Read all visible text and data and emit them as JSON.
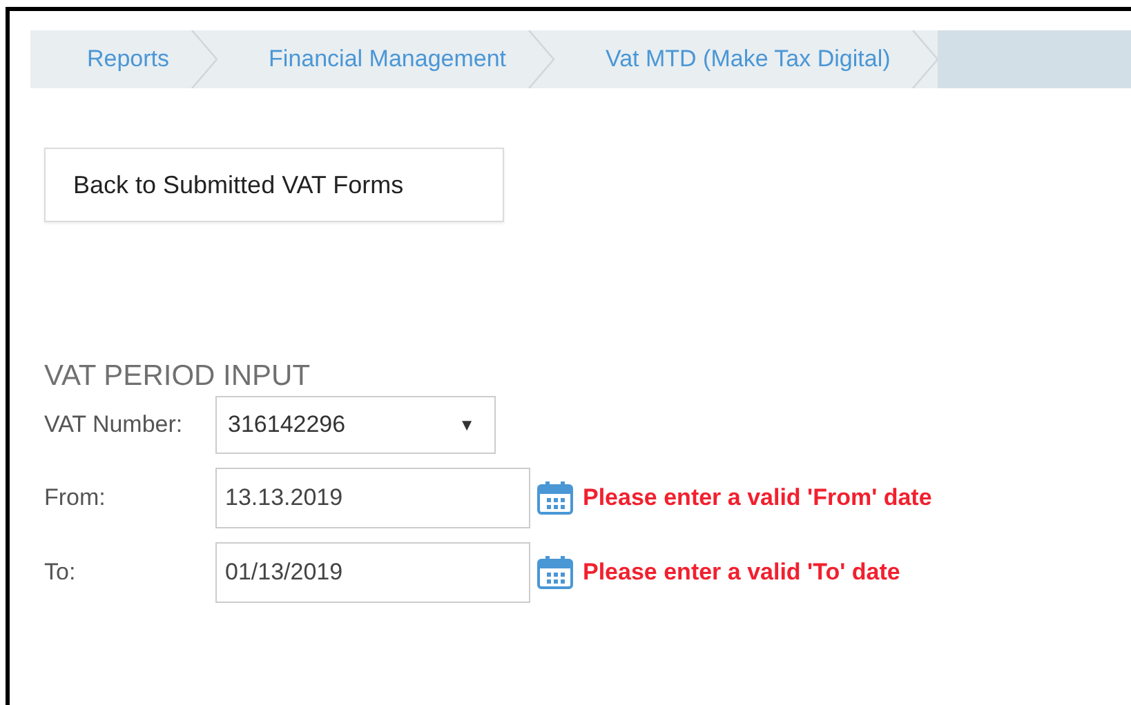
{
  "breadcrumbs": [
    {
      "label": "Reports",
      "selected": false
    },
    {
      "label": "Financial Management",
      "selected": false
    },
    {
      "label": "Vat MTD (Make Tax Digital)",
      "selected": false
    },
    {
      "selected": true
    }
  ],
  "back_button": "Back to Submitted VAT Forms",
  "section_title": "VAT PERIOD INPUT",
  "fields": [
    {
      "kind": "select",
      "label": "VAT Number:",
      "value": "316142296",
      "caret": "▼"
    },
    {
      "kind": "date",
      "label": "From:",
      "value": "13.13.2019",
      "error": "Please enter a valid 'From' date"
    },
    {
      "kind": "date",
      "label": "To:",
      "value": "01/13/2019",
      "error": "Please enter a valid 'To' date"
    }
  ]
}
